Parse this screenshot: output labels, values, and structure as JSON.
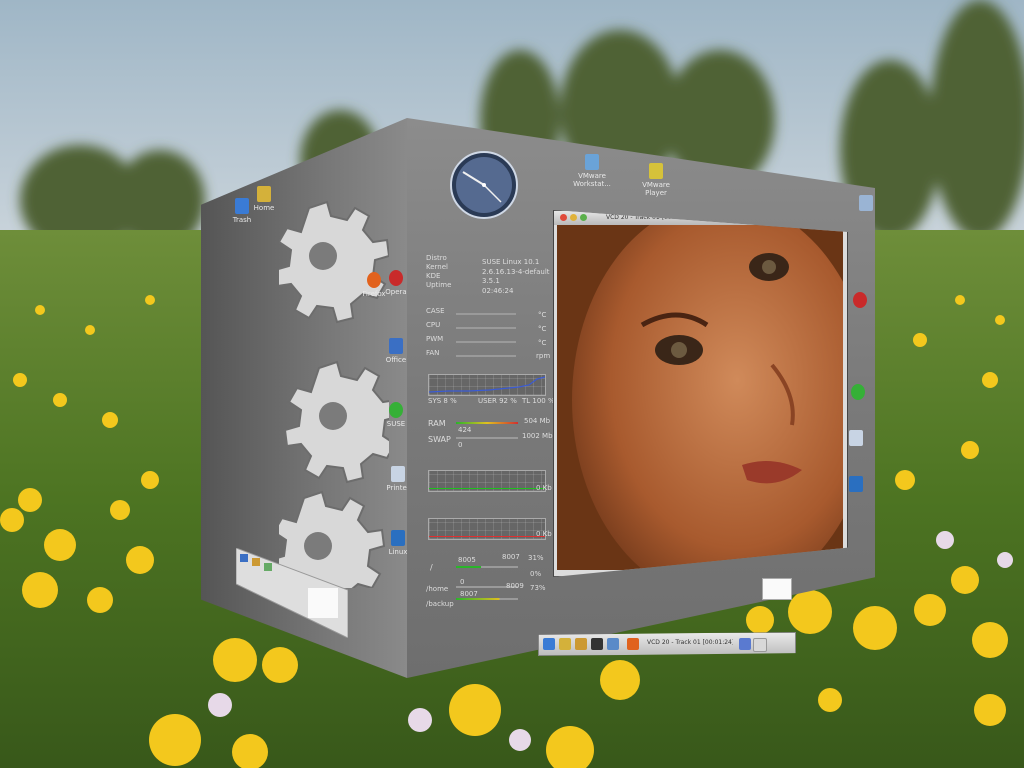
{
  "left_face": {
    "icons": [
      {
        "name": "trash-icon",
        "label": "Trash"
      },
      {
        "name": "home-icon",
        "label": "Home"
      },
      {
        "name": "firefox-icon",
        "label": "Firefox"
      },
      {
        "name": "opera-icon",
        "label": "Opera"
      },
      {
        "name": "office-icon",
        "label": "Office"
      },
      {
        "name": "suse-icon",
        "label": "SUSE"
      },
      {
        "name": "printer-icon",
        "label": "Printer"
      },
      {
        "name": "tux-icon",
        "label": "Linux"
      }
    ]
  },
  "front_face": {
    "desktop_icons": [
      {
        "name": "vmware-workstation-icon",
        "label": "VMware Workstat..."
      },
      {
        "name": "vmware-player-icon",
        "label": "VMware Player"
      }
    ],
    "system_info": {
      "distro_label": "Distro",
      "distro_value": "SUSE Linux 10.1",
      "kernel_label": "Kernel",
      "kernel_value": "2.6.16.13-4-default",
      "kde_label": "KDE",
      "kde_value": "3.5.1",
      "uptime_label": "Uptime",
      "uptime_value": "02:46:24"
    },
    "sensors": [
      {
        "label": "CASE",
        "unit": "°C"
      },
      {
        "label": "CPU",
        "unit": "°C"
      },
      {
        "label": "PWM",
        "unit": "°C"
      },
      {
        "label": "FAN",
        "unit": "rpm"
      }
    ],
    "cpu_graph": {
      "sys": "SYS 8 %",
      "user": "USER 92 %",
      "total": "TL 100 %"
    },
    "memory": [
      {
        "label": "RAM",
        "used": "424",
        "total": "504 Mb"
      },
      {
        "label": "SWAP",
        "used": "0",
        "total": "1002 Mb"
      }
    ],
    "net_graphs": [
      {
        "value": "0 Kb",
        "color": "#1fc01f"
      },
      {
        "value": "0 Kb",
        "color": "#e03030"
      }
    ],
    "disks": [
      {
        "label": "/",
        "used": "8005",
        "total": "8007",
        "percent": "31%"
      },
      {
        "label": "/home",
        "used": "0",
        "total": "",
        "percent": "0%"
      },
      {
        "label": "/backup",
        "used": "8007",
        "total": "8009",
        "percent": "73%"
      }
    ],
    "video_title": "VCD 20 - Track 01 [00:01:24] - mplayer",
    "taskbar_task": "VCD 20 - Track 01 [00:01:24]"
  },
  "colors": {
    "sky": "#b7c8d6",
    "grass": "#4f7a24",
    "dandelion": "#f4cc1c",
    "cube": "#7b7b7b"
  }
}
